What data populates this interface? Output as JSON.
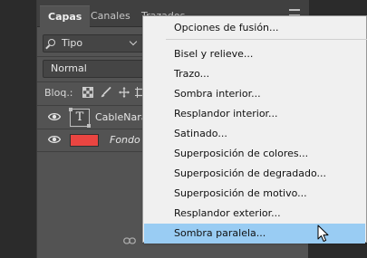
{
  "panel": {
    "tabs": [
      {
        "label": "Capas",
        "active": true
      },
      {
        "label": "Canales",
        "active": false
      },
      {
        "label": "Trazados",
        "active": false
      }
    ],
    "filter": {
      "label": "Tipo",
      "icon": "search-icon"
    },
    "blend_mode": "Normal",
    "lock_label": "Bloq.:",
    "layers": [
      {
        "name": "CableNaranja",
        "type": "text",
        "thumb": "T",
        "visible": true
      },
      {
        "name": "Fondo",
        "type": "fill",
        "color": "#ea4541",
        "visible": true
      }
    ],
    "bottom_icons": [
      "link-icon",
      "fx-icon"
    ]
  },
  "context_menu": {
    "items": [
      {
        "label": "Opciones de fusión...",
        "highlighted": false
      },
      {
        "label": "Bisel y relieve...",
        "highlighted": false
      },
      {
        "label": "Trazo...",
        "highlighted": false
      },
      {
        "label": "Sombra interior...",
        "highlighted": false
      },
      {
        "label": "Resplandor interior...",
        "highlighted": false
      },
      {
        "label": "Satinado...",
        "highlighted": false
      },
      {
        "label": "Superposición de colores...",
        "highlighted": false
      },
      {
        "label": "Superposición de degradado...",
        "highlighted": false
      },
      {
        "label": "Superposición de motivo...",
        "highlighted": false
      },
      {
        "label": "Resplandor exterior...",
        "highlighted": false
      },
      {
        "label": "Sombra paralela...",
        "highlighted": true
      }
    ],
    "highlight_color": "#99ccf3"
  },
  "colors": {
    "panel_bg": "#535353",
    "fondo_swatch": "#ea4541"
  }
}
